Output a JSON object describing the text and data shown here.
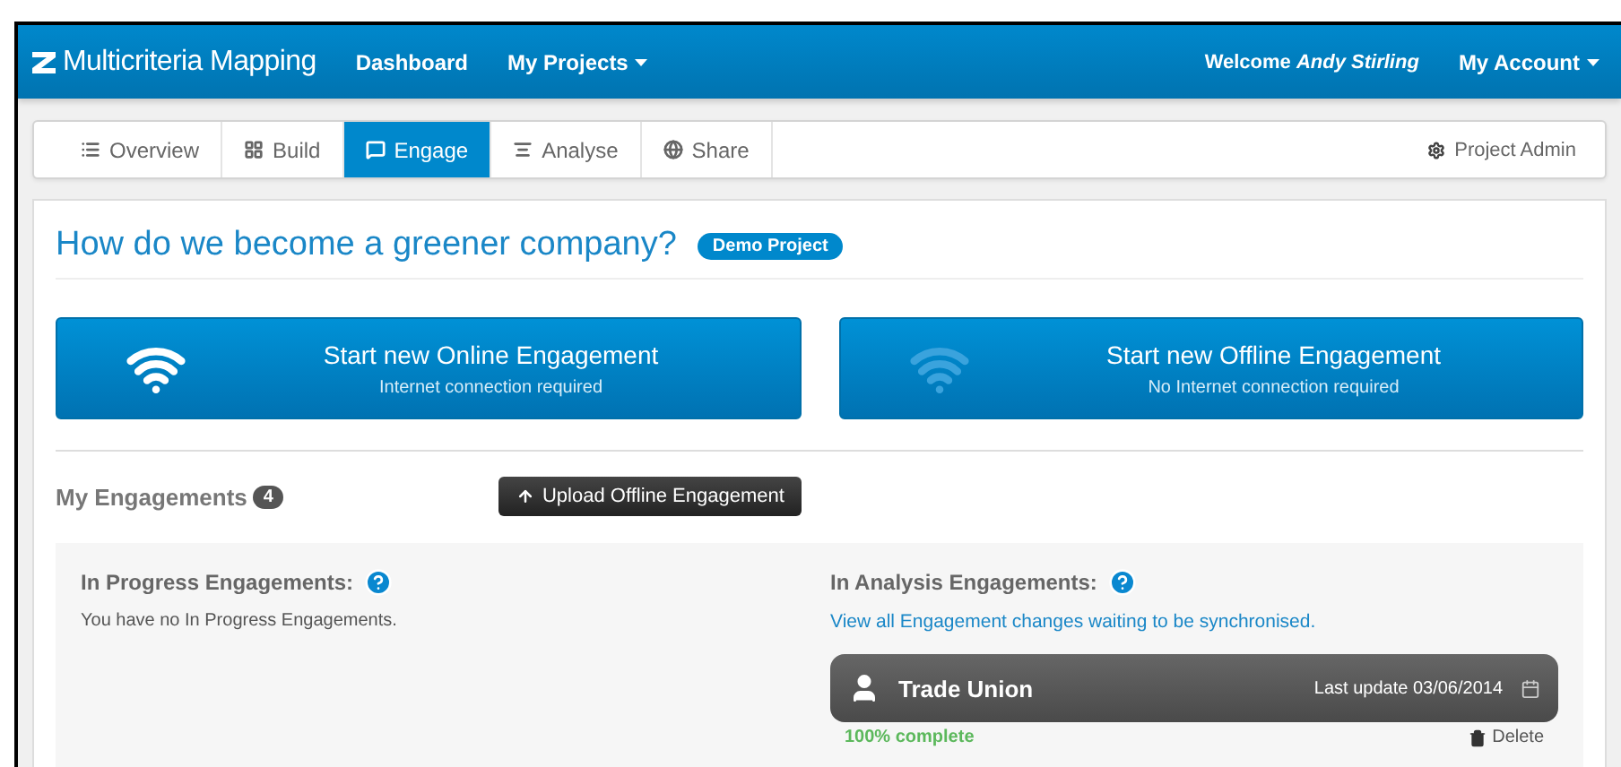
{
  "navbar": {
    "brand": "Multicriteria Mapping",
    "links": [
      {
        "label": "Dashboard",
        "dropdown": false
      },
      {
        "label": "My Projects",
        "dropdown": true
      }
    ],
    "welcome": "Welcome *Andy Stirling*",
    "account": {
      "label": "My Account",
      "dropdown": true
    }
  },
  "tabs": [
    {
      "label": "Overview",
      "selected": false
    },
    {
      "label": "Build",
      "selected": false
    },
    {
      "label": "Engage",
      "selected": true
    },
    {
      "label": "Analyse",
      "selected": false
    },
    {
      "label": "Share",
      "selected": false
    }
  ],
  "project_admin": "Project Admin",
  "project": {
    "title": "How do we become a greener company?",
    "badge": "Demo Project"
  },
  "engagement_buttons": [
    {
      "kind": "online",
      "title": "Start new Online Engagement",
      "subtitle": "Internet connection required"
    },
    {
      "kind": "offline",
      "title": "Start new Offline Engagement",
      "subtitle": "No Internet connection required"
    }
  ],
  "my_engagements": {
    "label": "My Engagements",
    "count": "4",
    "upload_button": "Upload Offline Engagement"
  },
  "in_progress": {
    "heading": "In Progress Engagements:",
    "message": "You have no In Progress Engagements."
  },
  "in_analysis": {
    "heading": "In Analysis Engagements:",
    "link": "View all Engagement changes waiting to be synchronised.",
    "cards": [
      {
        "name": "Trade Union",
        "last_update": "Last update 03/06/2014",
        "progress": "100% complete",
        "delete": "Delete"
      }
    ]
  }
}
